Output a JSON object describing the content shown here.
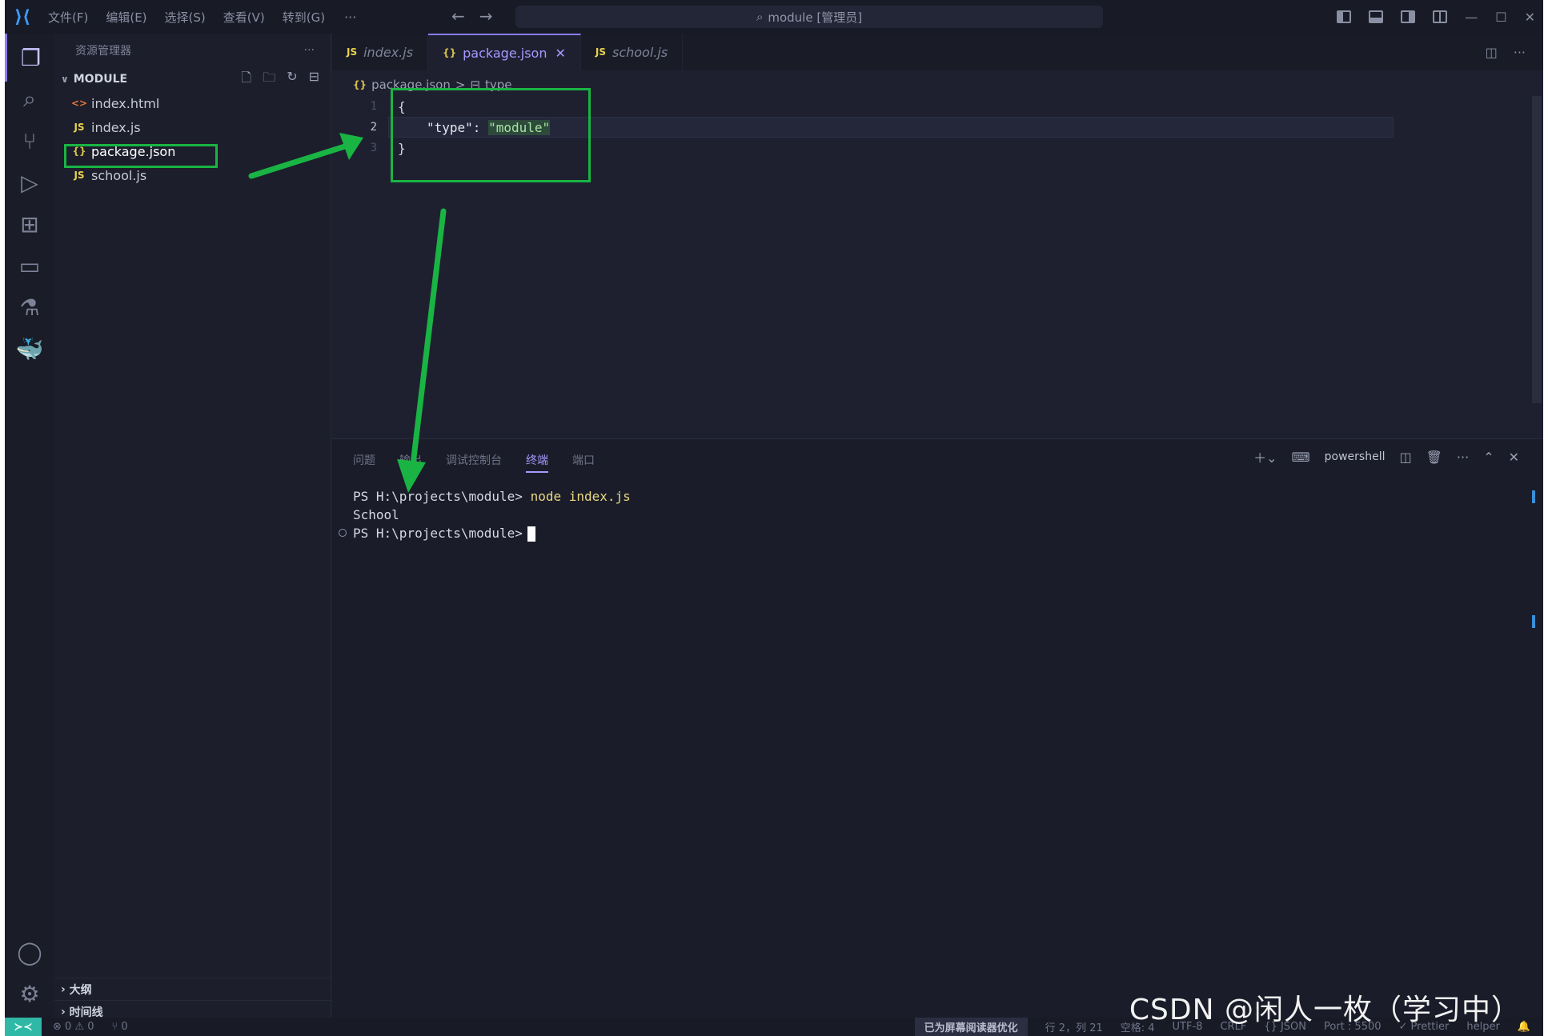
{
  "titlebar": {
    "menus": [
      "文件(F)",
      "编辑(E)",
      "选择(S)",
      "查看(V)",
      "转到(G)"
    ],
    "more": "···",
    "command_center": "module [管理员]"
  },
  "sidebar": {
    "title": "资源管理器",
    "more": "···",
    "section": "MODULE",
    "files": [
      {
        "name": "index.html",
        "icon": "<>"
      },
      {
        "name": "index.js",
        "icon": "JS"
      },
      {
        "name": "package.json",
        "icon": "{}"
      },
      {
        "name": "school.js",
        "icon": "JS"
      }
    ],
    "outline": "大纲",
    "timeline": "时间线"
  },
  "tabs": [
    {
      "label": "index.js",
      "icon": "JS"
    },
    {
      "label": "package.json",
      "icon": "{}"
    },
    {
      "label": "school.js",
      "icon": "JS"
    }
  ],
  "breadcrumb": {
    "file": "package.json",
    "sep": ">",
    "item": "type"
  },
  "code": {
    "lines": [
      {
        "num": "1",
        "text": "{"
      },
      {
        "num": "2",
        "key": "\"type\": ",
        "str": "\"module\""
      },
      {
        "num": "3",
        "text": "}"
      }
    ]
  },
  "panel": {
    "tabs": [
      "问题",
      "输出",
      "调试控制台",
      "终端",
      "端口"
    ],
    "shell": "powershell",
    "terminal": {
      "prompt": "PS H:\\projects\\module>",
      "command": "node index.js",
      "output": "School"
    }
  },
  "statusbar": {
    "errors": "⊗ 0 ⚠ 0",
    "ports": "⑂ 0",
    "screen_reader": "已为屏幕阅读器优化",
    "position": "行 2，列 21",
    "spaces": "空格: 4",
    "encoding": "UTF-8",
    "eol": "CRLF",
    "language": "{} JSON",
    "port": "Port : 5500",
    "prettier": "✓ Prettier",
    "helper": "helper"
  },
  "watermark": "CSDN @闲人一枚（学习中）",
  "colors": {
    "annotation": "#19b443",
    "accent": "#a699ff",
    "background": "#1e2030"
  }
}
